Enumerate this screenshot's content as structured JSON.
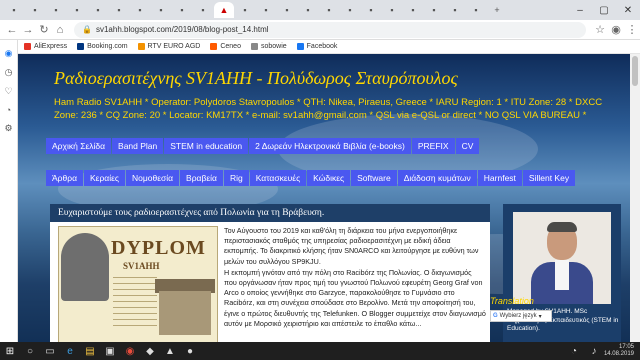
{
  "browser": {
    "url": "sv1ahh.blogspot.com/2019/08/blog-post_14.html",
    "bookmarks": [
      "AliExpress",
      "Booking.com",
      "RTV EURO AGD",
      "Ceneo",
      "sobowie",
      "Facebook"
    ]
  },
  "site": {
    "title": "Ραδιοερασιτέχνης SV1AHH - Πολύδωρος Σταυρόπουλος",
    "info": "Ham Radio SV1AHH * Operator: Polydoros Stavropoulos * QTH: Nikea, Piraeus, Greece * IARU Region: 1 * ITU Zone: 28 * DXCC Zone: 236 * CQ Zone: 20 * Locator: KM17TX * e-mail: sv1ahh@gmail.com * QSL via e-QSL or direct * NO QSL VIA BUREAU *"
  },
  "menu1": [
    "Αρχική Σελίδα",
    "Band Plan",
    "STEM in education",
    "2 Δωρεάν Ηλεκτρονικά Βιβλία (e-books)",
    "PREFIX",
    "CV"
  ],
  "menu2": [
    "Άρθρα",
    "Κεραίες",
    "Νομοθεσία",
    "Βραβεία",
    "Rig",
    "Κατασκευές",
    "Κώδικες",
    "Software",
    "Διάδοση κυμάτων",
    "Harnfest",
    "Sillent Key"
  ],
  "post": {
    "heading": "Ευχαριστούμε τους ραδιοερασιτέχνες από Πολωνία για τη Βράβευση.",
    "diploma_title": "DYPLOM",
    "diploma_call": "SV1AHH",
    "p1": "Τον Αύγουστο του 2019 και καθ'όλη τη διάρκεια του μήνα ενεργοποιήθηκε περιστασιακός σταθμός της υπηρεσίας ραδιοερασιτέχνη με ειδική άδεια εκπομπής. Το διακριτικό κλήσης ήταν SN0ARCO και λειτούργησε με ευθύνη των μελών του συλλόγου SP9KJU.",
    "p2": "Η εκπομπή γινόταν από την πόλη στο Racibórz της Πολωνίας. Ο διαγωνισμός που οργάνωσαν ήταν προς τιμή του γνωστού Πολωνού εφευρέτη Georg Graf von Arco ο οποίος γεννήθηκε στο Garzyce, παρακολούθησε το Γυμνάσιο στο Racibórz, και στη συνέχεια σπούδασε στο Βερολίνο. Μετά την αποφοίτησή του, έγινε ο πρώτος διευθυντής της Telefunken. Ο Blogger συμμετείχε στον διαγωνισμό αυτόν με Μορσικό χειριστήριο και απέστειλε το έπαθλο κάτω..."
  },
  "sidebar": {
    "profile_text": "Managed by SV1AHH. MSc Μηχανολόγος Εκπαιδευτικός (STEM in Education).",
    "translation_title": "Translation",
    "translate_label": "Wybierz język"
  },
  "taskbar": {
    "time": "17:05",
    "date": "14.08.2019"
  }
}
